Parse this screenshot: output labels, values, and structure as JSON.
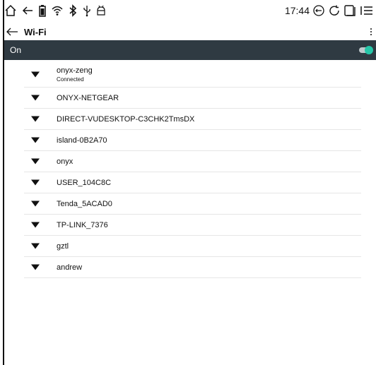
{
  "status_bar": {
    "time": "17:44",
    "left_icons": [
      "home-icon",
      "back-icon",
      "battery-icon",
      "wifi-icon",
      "bluetooth-icon",
      "usb-icon",
      "android-icon"
    ],
    "right_icons": [
      "back-circle-icon",
      "refresh-icon",
      "screenshot-icon",
      "menu-icon"
    ]
  },
  "appbar": {
    "title": "Wi-Fi"
  },
  "switch": {
    "label": "On",
    "state": "on",
    "accent": "#26c6a8",
    "bar_color": "#2f3a42"
  },
  "networks": [
    {
      "name": "onyx-zeng",
      "status": "Connected"
    },
    {
      "name": "ONYX-NETGEAR"
    },
    {
      "name": "DIRECT-VUDESKTOP-C3CHK2TmsDX"
    },
    {
      "name": "island-0B2A70"
    },
    {
      "name": "onyx"
    },
    {
      "name": "USER_104C8C"
    },
    {
      "name": "Tenda_5ACAD0"
    },
    {
      "name": "TP-LINK_7376"
    },
    {
      "name": "gztl"
    },
    {
      "name": "andrew"
    }
  ]
}
